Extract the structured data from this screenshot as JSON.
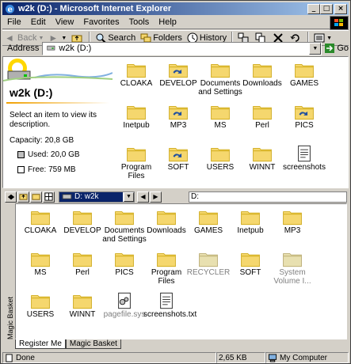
{
  "window": {
    "title": "w2k (D:) - Microsoft Internet Explorer"
  },
  "menu": [
    "File",
    "Edit",
    "View",
    "Favorites",
    "Tools",
    "Help"
  ],
  "toolbar": {
    "back": "Back",
    "search": "Search",
    "folders": "Folders",
    "history": "History"
  },
  "address": {
    "label": "Address",
    "value": "w2k (D:)",
    "go": "Go"
  },
  "webview": {
    "title": "w2k (D:)",
    "hint": "Select an item to view its description.",
    "capacity": "Capacity: 20,8 GB",
    "used": "Used: 20,0 GB",
    "free": "Free: 759 MB"
  },
  "upper_items": [
    {
      "label": "CLOAKA",
      "type": "folder"
    },
    {
      "label": "DEVELOP",
      "type": "folder-shared"
    },
    {
      "label": "Documents and Settings",
      "type": "folder"
    },
    {
      "label": "Downloads",
      "type": "folder"
    },
    {
      "label": "GAMES",
      "type": "folder"
    },
    {
      "label": "Inetpub",
      "type": "folder"
    },
    {
      "label": "MP3",
      "type": "folder-shared"
    },
    {
      "label": "MS",
      "type": "folder"
    },
    {
      "label": "Perl",
      "type": "folder"
    },
    {
      "label": "PICS",
      "type": "folder-shared"
    },
    {
      "label": "Program Files",
      "type": "folder"
    },
    {
      "label": "SOFT",
      "type": "folder-shared"
    },
    {
      "label": "USERS",
      "type": "folder"
    },
    {
      "label": "WINNT",
      "type": "folder"
    },
    {
      "label": "screenshots",
      "type": "textfile"
    }
  ],
  "lower": {
    "drive": "D: w2k",
    "path": "D:",
    "sidebar_label": "Magic Basket",
    "tabs": [
      "Register Me",
      "Magic Basket"
    ]
  },
  "lower_items": [
    {
      "label": "CLOAKA",
      "type": "folder"
    },
    {
      "label": "DEVELOP",
      "type": "folder"
    },
    {
      "label": "Documents and Settings",
      "type": "folder"
    },
    {
      "label": "Downloads",
      "type": "folder"
    },
    {
      "label": "GAMES",
      "type": "folder"
    },
    {
      "label": "Inetpub",
      "type": "folder"
    },
    {
      "label": "MP3",
      "type": "folder"
    },
    {
      "label": "MS",
      "type": "folder"
    },
    {
      "label": "Perl",
      "type": "folder"
    },
    {
      "label": "PICS",
      "type": "folder"
    },
    {
      "label": "Program Files",
      "type": "folder"
    },
    {
      "label": "RECYCLER",
      "type": "folder-grey"
    },
    {
      "label": "SOFT",
      "type": "folder"
    },
    {
      "label": "System Volume I...",
      "type": "folder-grey"
    },
    {
      "label": "USERS",
      "type": "folder"
    },
    {
      "label": "WINNT",
      "type": "folder"
    },
    {
      "label": "pagefile.sys",
      "type": "sysfile"
    },
    {
      "label": "screenshots.txt",
      "type": "textfile"
    }
  ],
  "status": {
    "left": "Done",
    "size": "2,65 KB",
    "zone": "My Computer"
  }
}
